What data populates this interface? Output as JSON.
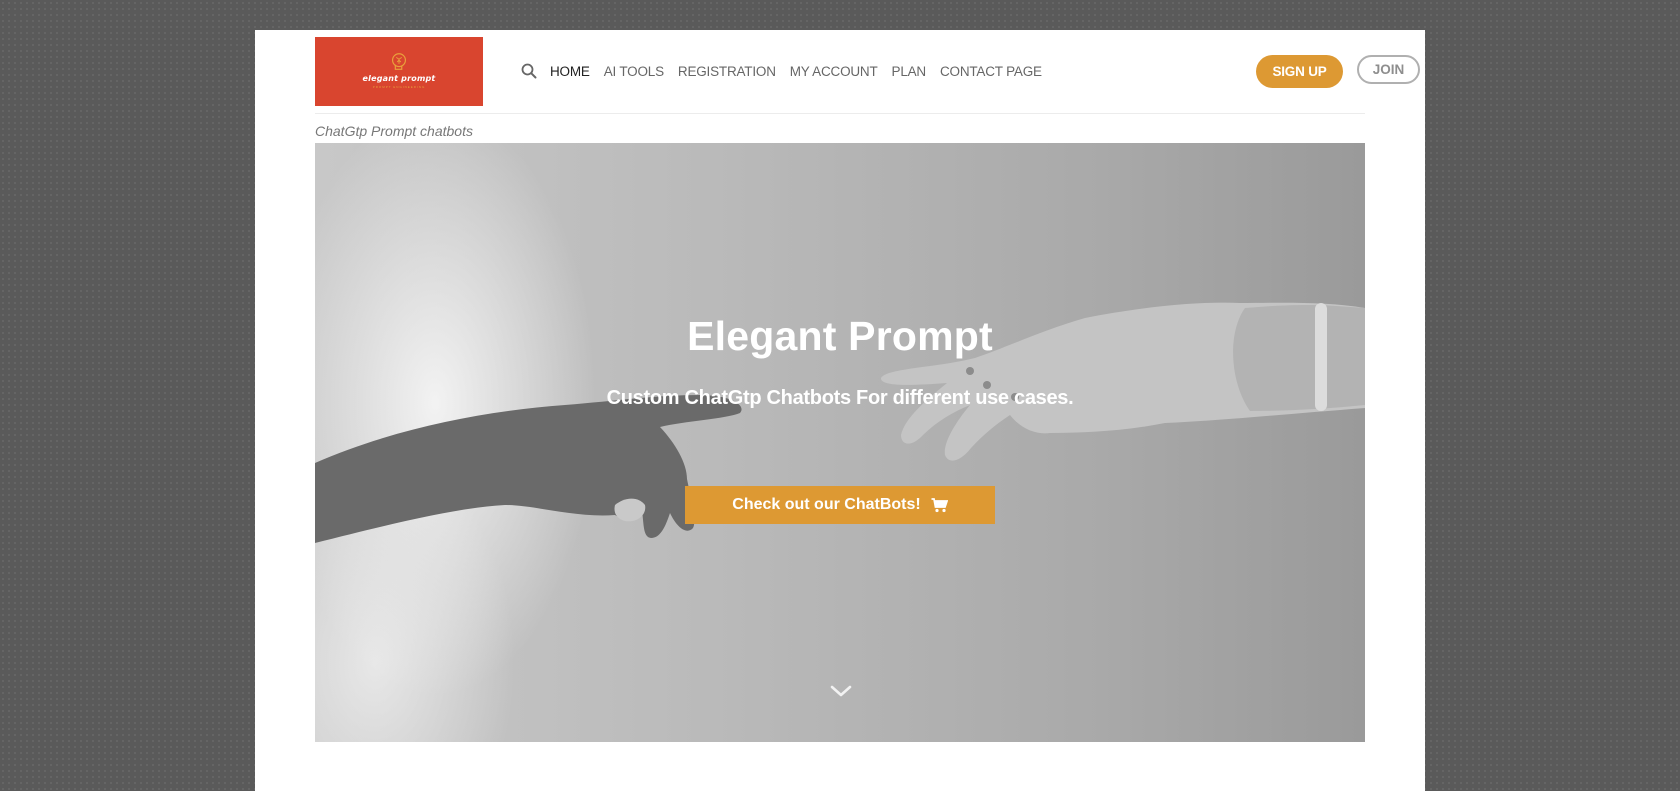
{
  "logo": {
    "name": "elegant prompt",
    "tagline": "PROMPT ENGINEERING",
    "bg_color": "#d9452f"
  },
  "nav": {
    "search_icon": "search-icon",
    "items": [
      {
        "label": "HOME",
        "active": true
      },
      {
        "label": "AI TOOLS",
        "active": false
      },
      {
        "label": "REGISTRATION",
        "active": false
      },
      {
        "label": "MY ACCOUNT",
        "active": false
      },
      {
        "label": "PLAN",
        "active": false
      },
      {
        "label": "CONTACT PAGE",
        "active": false
      }
    ]
  },
  "header_buttons": {
    "signup_label": "SIGN UP",
    "join_label": "JOIN",
    "accent_color": "#dd9933"
  },
  "caption": "ChatGtp Prompt chatbots",
  "hero": {
    "title": "Elegant Prompt",
    "subtitle": "Custom ChatGtp Chatbots For different use cases.",
    "cta_label": "Check out our ChatBots!",
    "cta_icon": "cart-icon",
    "scroll_icon": "chevron-down-icon"
  }
}
